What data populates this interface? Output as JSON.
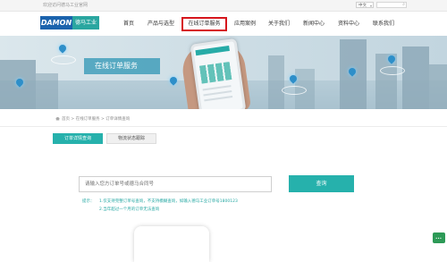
{
  "topbar": {
    "welcome": "欢迎访问德马工业官网",
    "language": "中文"
  },
  "header": {
    "logo_brand": "DAMON",
    "logo_cn": "德马工业",
    "nav": [
      {
        "label": "首页"
      },
      {
        "label": "产品与选型"
      },
      {
        "label": "在线订单服务",
        "active": true
      },
      {
        "label": "应用案例"
      },
      {
        "label": "关于我们"
      },
      {
        "label": "新闻中心"
      },
      {
        "label": "资料中心"
      },
      {
        "label": "联系我们"
      }
    ]
  },
  "banner": {
    "title": "在线订单服务"
  },
  "breadcrumb": "首页 > 在线订单服务 > 订单详情查询",
  "tabs": {
    "active": "订单详情查询",
    "inactive": "物流状态跟踪"
  },
  "search": {
    "placeholder": "请输入您方订单号或德马合同号",
    "button": "查询"
  },
  "tips": {
    "label": "提示：",
    "line1": "1.仅支持完整订单号查询，不支持模糊查询，如输入德马工业订单号1800123",
    "line2": "2.当年超过一个月的订单无法查询"
  },
  "colors": {
    "accent": "#26b1ac",
    "active_border": "#d6161d",
    "logo_blue": "#1b63ad"
  }
}
